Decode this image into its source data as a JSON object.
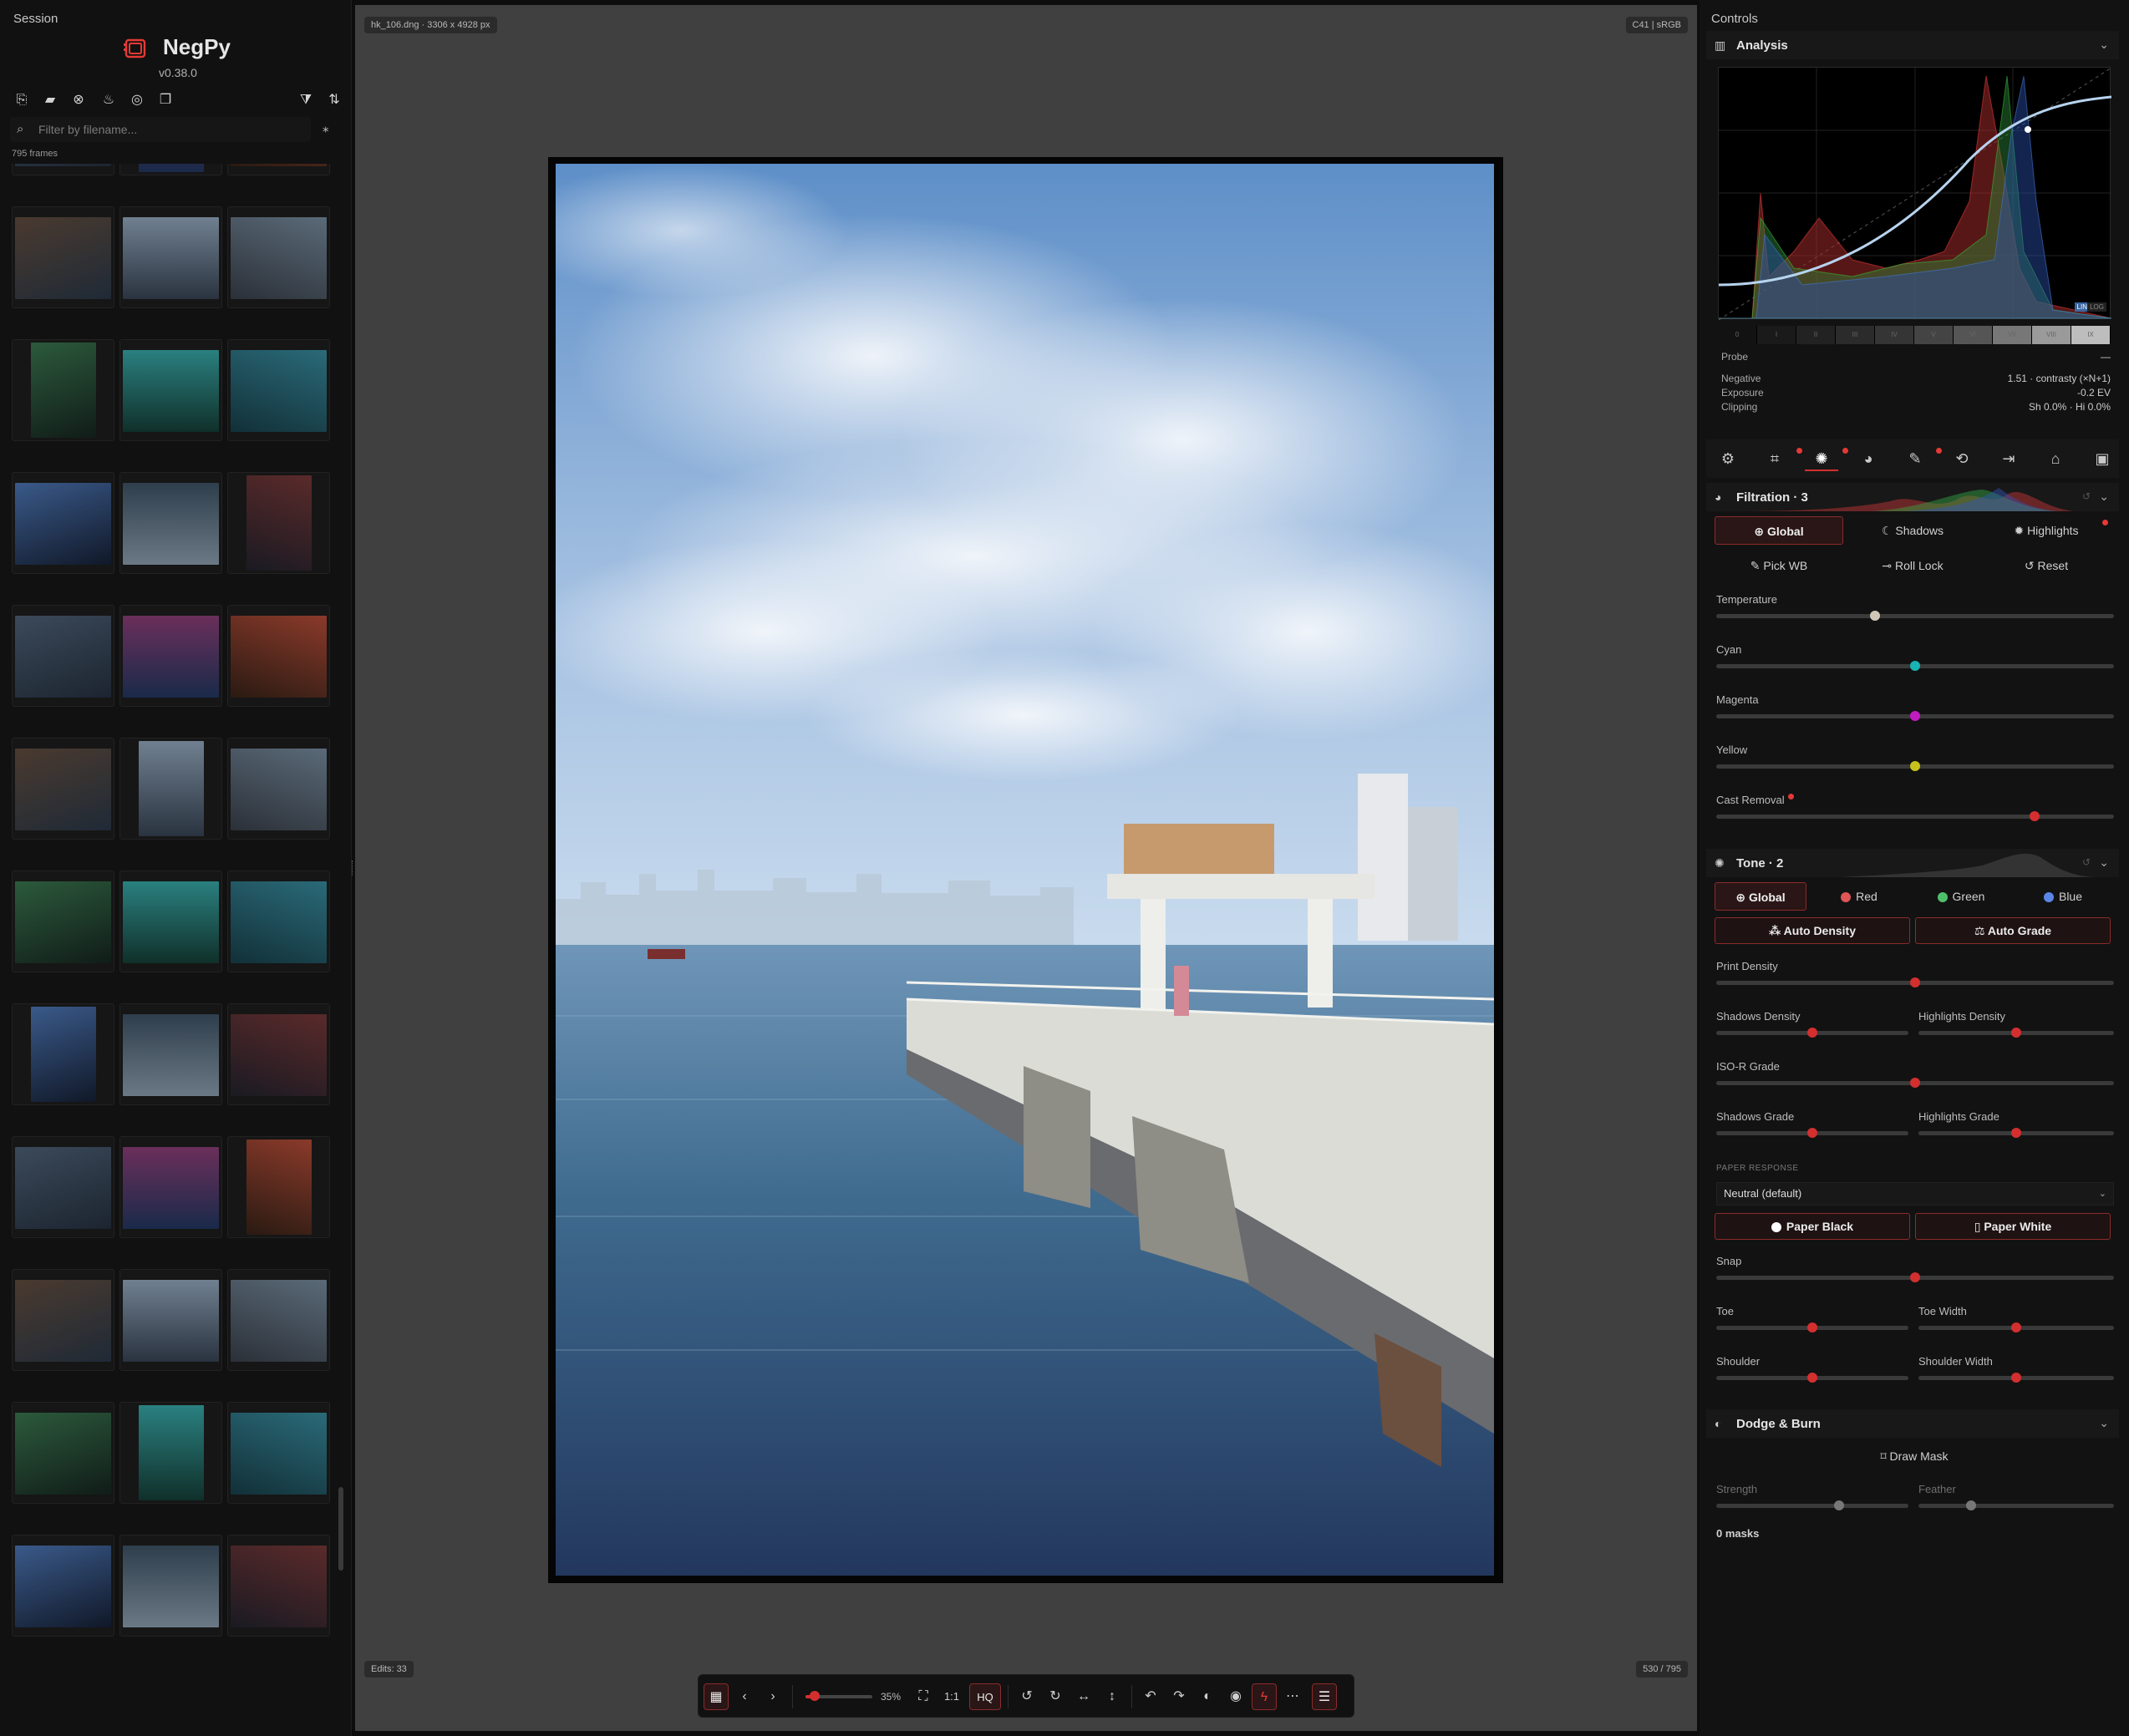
{
  "sidebar": {
    "title": "Session",
    "app_name": "NegPy",
    "version": "v0.38.0",
    "filter_placeholder": "Filter by filename...",
    "frames_count": "795 frames",
    "toolbar_icons": [
      "import-file-icon",
      "import-folder-icon",
      "clear-icon",
      "burn-icon",
      "target-icon",
      "copy-icon",
      "filter-icon",
      "sort-icon"
    ]
  },
  "viewer": {
    "file_info": "hk_106.dng · 3306 x 4928 px",
    "color_info": "C41 | sRGB",
    "edits": "Edits: 33",
    "position": "530 / 795",
    "zoom": "35%",
    "one_to_one": "1:1",
    "hq": "HQ"
  },
  "controls": {
    "title": "Controls",
    "analysis": {
      "title": "Analysis",
      "scale_mode_lin": "LIN",
      "scale_mode_log": "LOG",
      "probe_label": "Probe",
      "probe_value": "—",
      "negative_label": "Negative",
      "negative_value": "1.51 · contrasty (×N+1)",
      "exposure_label": "Exposure",
      "exposure_value": "-0.2 EV",
      "clipping_label": "Clipping",
      "clipping_value": "Sh 0.0% · Hi 0.0%"
    },
    "filtration": {
      "title": "Filtration · 3",
      "modes": [
        "Global",
        "Shadows",
        "Highlights"
      ],
      "actions": [
        "Pick WB",
        "Roll Lock",
        "Reset"
      ],
      "sliders": [
        {
          "label": "Temperature",
          "value": 0.4,
          "color": "#d0c7b8"
        },
        {
          "label": "Cyan",
          "value": 0.5,
          "color": "#19b3b3"
        },
        {
          "label": "Magenta",
          "value": 0.5,
          "color": "#c21bc2"
        },
        {
          "label": "Yellow",
          "value": 0.5,
          "color": "#c6c21b"
        },
        {
          "label": "Cast Removal",
          "value": 0.8,
          "color": "#d32f2f"
        }
      ]
    },
    "tone": {
      "title": "Tone · 2",
      "channels": [
        "Global",
        "Red",
        "Green",
        "Blue"
      ],
      "auto_density": "Auto Density",
      "auto_grade": "Auto Grade",
      "print_density": "Print Density",
      "shadows_density": "Shadows Density",
      "highlights_density": "Highlights Density",
      "iso_r_grade": "ISO-R Grade",
      "shadows_grade": "Shadows Grade",
      "highlights_grade": "Highlights Grade",
      "paper_response_label": "PAPER RESPONSE",
      "paper_response_value": "Neutral (default)",
      "paper_black": "Paper Black",
      "paper_white": "Paper White",
      "snap": "Snap",
      "toe": "Toe",
      "toe_width": "Toe Width",
      "shoulder": "Shoulder",
      "shoulder_width": "Shoulder Width",
      "values": {
        "print_density": 0.5,
        "shadows_density": 0.5,
        "highlights_density": 0.5,
        "iso_r_grade": 0.5,
        "shadows_grade": 0.5,
        "highlights_grade": 0.5,
        "snap": 0.5,
        "toe": 0.5,
        "toe_width": 0.5,
        "shoulder": 0.5,
        "shoulder_width": 0.5
      }
    },
    "dodge_burn": {
      "title": "Dodge & Burn",
      "draw_mask": "Draw Mask",
      "strength": "Strength",
      "feather": "Feather",
      "strength_value": 0.64,
      "feather_value": 0.27,
      "masks": "0 masks"
    }
  }
}
